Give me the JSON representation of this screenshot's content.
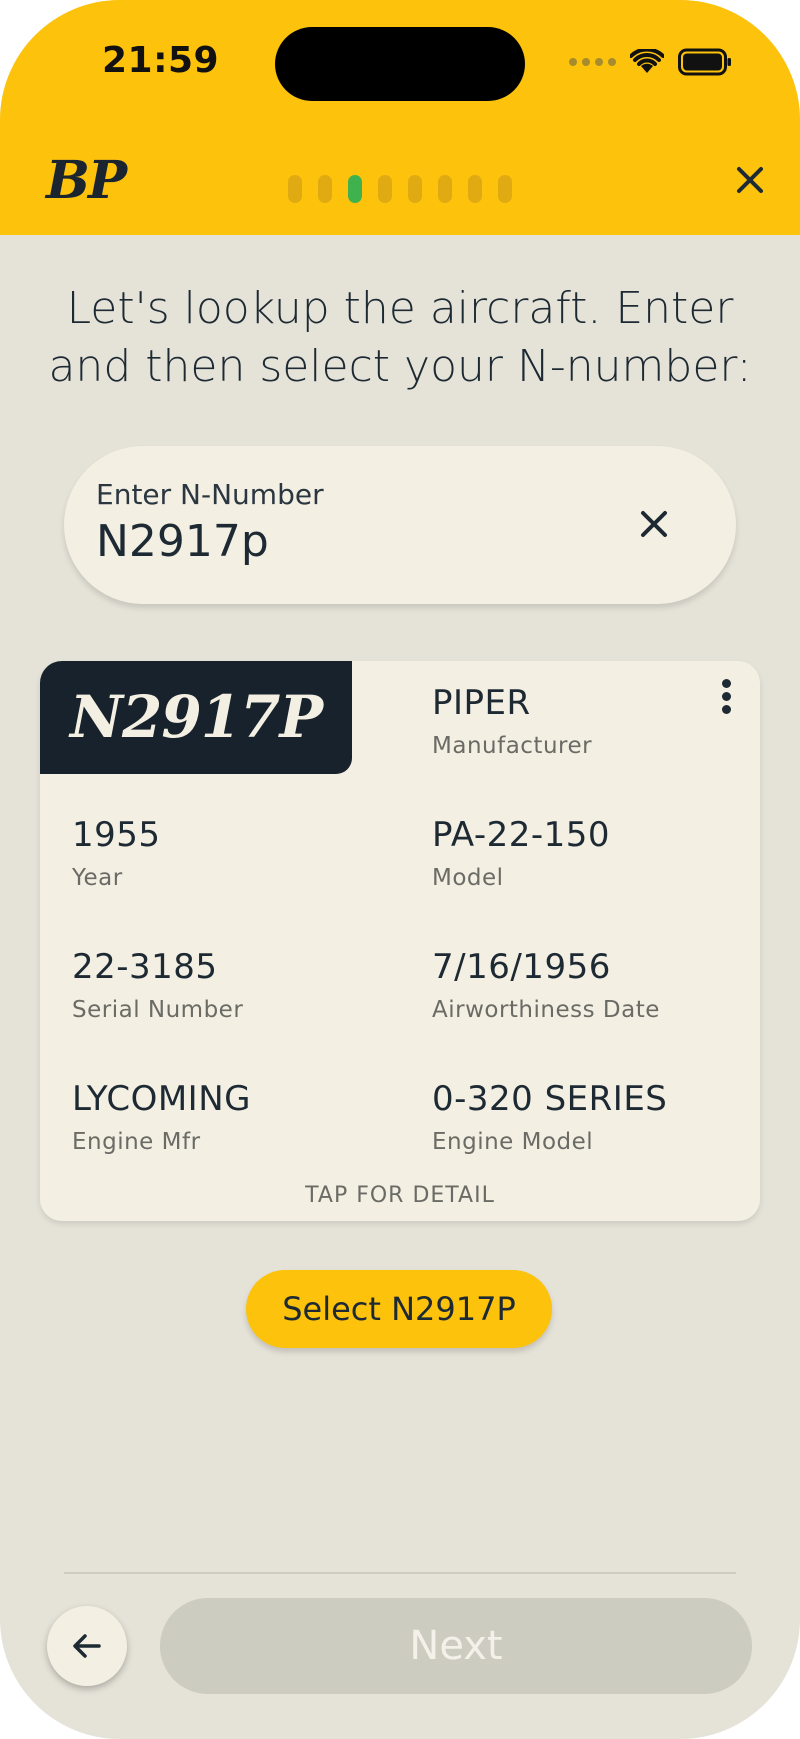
{
  "status_bar": {
    "time": "21:59"
  },
  "header": {
    "logo": "BP",
    "progress": {
      "total_steps": 8,
      "current_step": 3
    }
  },
  "prompt": "Let's lookup the aircraft. Enter and then select your N-number:",
  "search": {
    "label": "Enter N-Number",
    "value": "N2917p"
  },
  "aircraft_card": {
    "tail_number": "N2917P",
    "fields": {
      "manufacturer": {
        "value": "PIPER",
        "label": "Manufacturer"
      },
      "year": {
        "value": "1955",
        "label": "Year"
      },
      "model": {
        "value": "PA-22-150",
        "label": "Model"
      },
      "serial": {
        "value": "22-3185",
        "label": "Serial Number"
      },
      "airworthiness": {
        "value": "7/16/1956",
        "label": "Airworthiness Date"
      },
      "engine_mfr": {
        "value": "LYCOMING",
        "label": "Engine Mfr"
      },
      "engine_model": {
        "value": "0-320 SERIES",
        "label": "Engine Model"
      }
    },
    "tap_hint": "TAP FOR DETAIL"
  },
  "select_button": "Select N2917P",
  "footer": {
    "next_label": "Next"
  },
  "colors": {
    "header_yellow": "#fdc20b",
    "background": "#e5e2d8",
    "card_bg": "#f4efe3",
    "badge_dark": "#17222c",
    "progress_active": "#3fb24f",
    "next_disabled": "#cdccc1"
  }
}
